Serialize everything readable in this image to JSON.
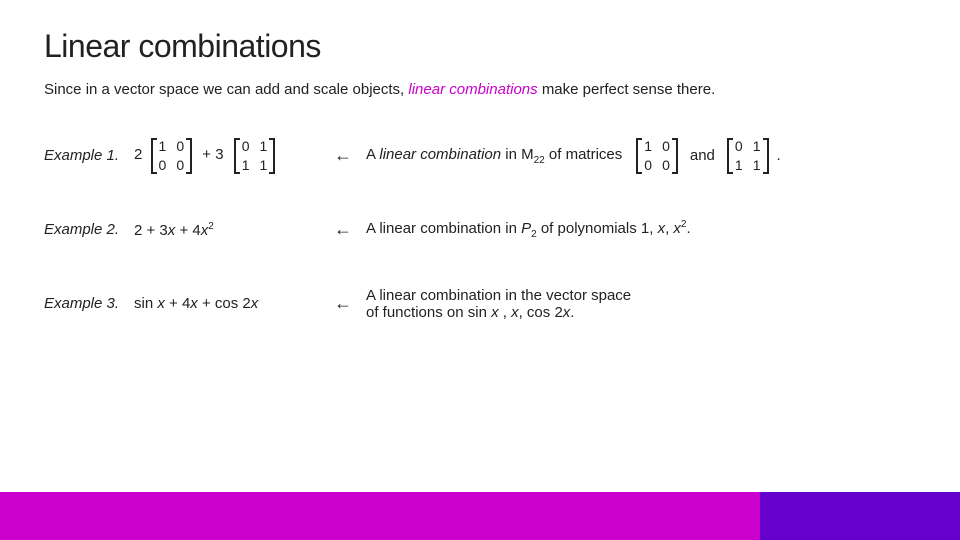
{
  "title": "Linear combinations",
  "subtitle": {
    "before": "Since in a vector space we can add and scale objects,",
    "highlight": "linear combinations",
    "after": "make perfect sense there."
  },
  "examples": [
    {
      "label": "Example 1.",
      "description": "A linear combination in M₂₂ of matrices"
    },
    {
      "label": "Example 2.",
      "description": "A linear combination in P₂ of polynomials 1, x, x²."
    },
    {
      "label": "Example 3.",
      "description_line1": "A linear combination in the vector space",
      "description_line2": "of functions on sin x , x, cos 2x."
    }
  ],
  "arrow_symbol": "←",
  "footer": {
    "left_color": "#cc00cc",
    "right_color": "#6600cc"
  }
}
